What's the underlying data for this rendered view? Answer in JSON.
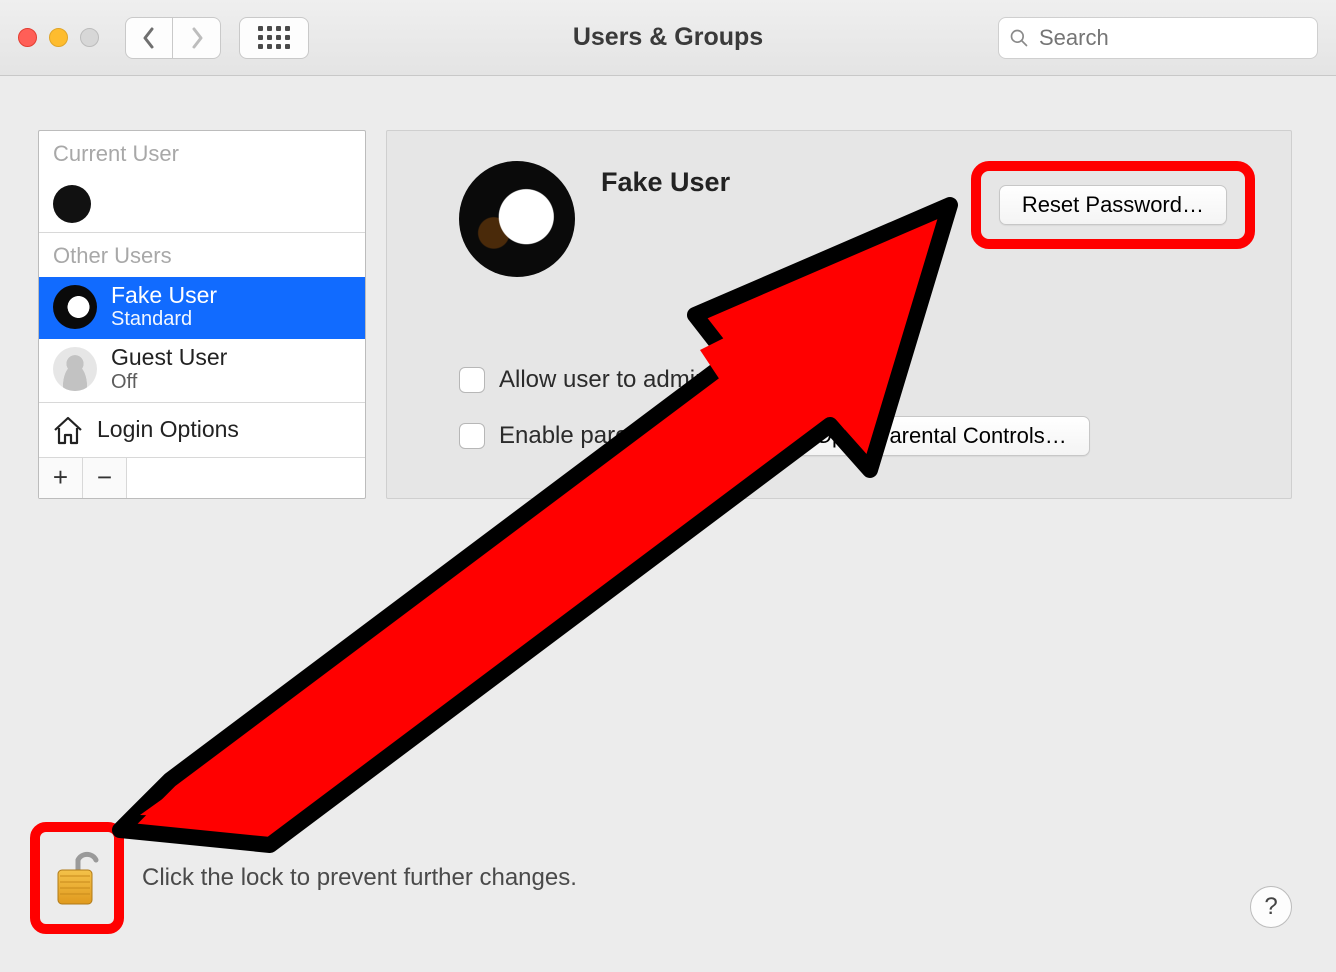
{
  "window": {
    "title": "Users & Groups",
    "search_placeholder": "Search"
  },
  "sidebar": {
    "current_user_header": "Current User",
    "other_users_header": "Other Users",
    "users": [
      {
        "name": "Fake User",
        "type": "Standard",
        "avatar": "eagle",
        "selected": true
      },
      {
        "name": "Guest User",
        "type": "Off",
        "avatar": "guest",
        "selected": false
      }
    ],
    "login_options_label": "Login Options"
  },
  "detail": {
    "user_name": "Fake User",
    "reset_password_label": "Reset Password…",
    "allow_admin_label": "Allow user to administer this computer",
    "allow_admin_checked": false,
    "enable_parental_label": "Enable parental controls",
    "enable_parental_checked": false,
    "open_parental_label": "Open Parental Controls…"
  },
  "footer": {
    "lock_text": "Click the lock to prevent further changes."
  },
  "annotations": {
    "highlight_reset_password": true,
    "highlight_lock": true,
    "arrow_from_lock_to_reset": true
  },
  "colors": {
    "annotation": "#ff0000",
    "selection": "#116bff"
  }
}
